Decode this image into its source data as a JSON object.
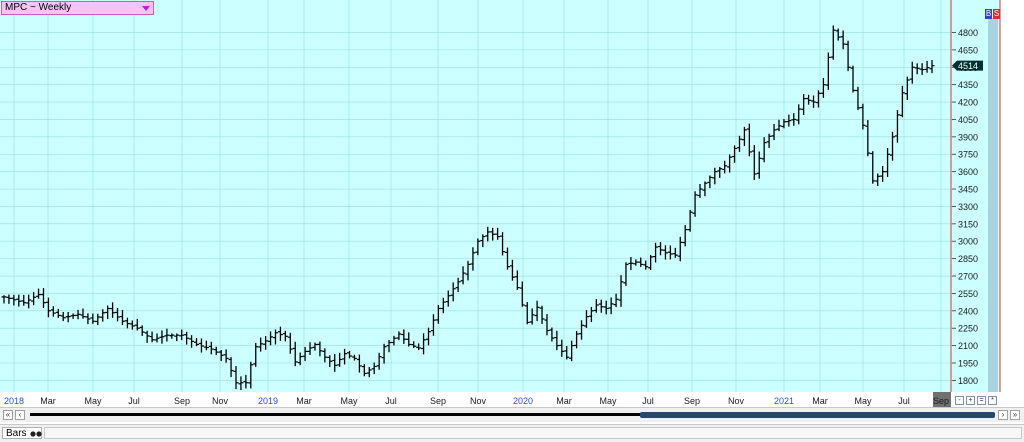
{
  "header": {
    "symbol_label": "MPC ~ Weekly"
  },
  "badges": {
    "b": "B",
    "s": "S"
  },
  "status": {
    "mode_label": "Bars"
  },
  "colors": {
    "plot_bg": "#ccffff",
    "grid": "#99dddd",
    "bar": "#000000",
    "marker_line": "#e03030",
    "axis_text": "#1a1a1a",
    "year_text": "#2050e0",
    "price_badge_bg": "#003030"
  },
  "chart_data": {
    "type": "bar",
    "style": "ohlc",
    "frequency": "weekly",
    "y_ticks": [
      1800,
      1950,
      2100,
      2250,
      2400,
      2550,
      2700,
      2850,
      3000,
      3150,
      3300,
      3450,
      3600,
      3750,
      3900,
      4050,
      4200,
      4350,
      4500,
      4650,
      4800
    ],
    "ylim": [
      1700,
      5080
    ],
    "last_price_label": "4514",
    "x_labels": [
      "2018",
      "Mar",
      "May",
      "Jul",
      "Sep",
      "Nov",
      "2019",
      "Mar",
      "May",
      "Jul",
      "Sep",
      "Nov",
      "2020",
      "Mar",
      "May",
      "Jul",
      "Sep",
      "Nov",
      "2021",
      "Mar",
      "May",
      "Jul",
      "Sep"
    ],
    "year_labels": [
      "2018",
      "2019",
      "2020",
      "2021"
    ],
    "anchors": [
      [
        0,
        2520
      ],
      [
        4,
        2470
      ],
      [
        7,
        2540
      ],
      [
        9,
        2400
      ],
      [
        12,
        2340
      ],
      [
        15,
        2370
      ],
      [
        18,
        2310
      ],
      [
        21,
        2420
      ],
      [
        24,
        2310
      ],
      [
        27,
        2250
      ],
      [
        30,
        2150
      ],
      [
        33,
        2190
      ],
      [
        36,
        2190
      ],
      [
        39,
        2110
      ],
      [
        42,
        2070
      ],
      [
        45,
        1990
      ],
      [
        47,
        1780
      ],
      [
        49,
        1780
      ],
      [
        51,
        2090
      ],
      [
        53,
        2140
      ],
      [
        55,
        2210
      ],
      [
        57,
        2180
      ],
      [
        59,
        1960
      ],
      [
        61,
        2050
      ],
      [
        63,
        2110
      ],
      [
        65,
        2000
      ],
      [
        67,
        1930
      ],
      [
        69,
        2030
      ],
      [
        71,
        1990
      ],
      [
        73,
        1860
      ],
      [
        75,
        1920
      ],
      [
        77,
        2090
      ],
      [
        80,
        2200
      ],
      [
        82,
        2110
      ],
      [
        84,
        2080
      ],
      [
        86,
        2220
      ],
      [
        88,
        2420
      ],
      [
        90,
        2530
      ],
      [
        92,
        2650
      ],
      [
        94,
        2800
      ],
      [
        96,
        3000
      ],
      [
        98,
        3080
      ],
      [
        100,
        3040
      ],
      [
        102,
        2780
      ],
      [
        104,
        2600
      ],
      [
        106,
        2300
      ],
      [
        108,
        2430
      ],
      [
        110,
        2230
      ],
      [
        112,
        2100
      ],
      [
        114,
        2000
      ],
      [
        116,
        2200
      ],
      [
        118,
        2350
      ],
      [
        120,
        2450
      ],
      [
        122,
        2420
      ],
      [
        124,
        2500
      ],
      [
        126,
        2800
      ],
      [
        128,
        2820
      ],
      [
        130,
        2780
      ],
      [
        132,
        2950
      ],
      [
        134,
        2900
      ],
      [
        136,
        2880
      ],
      [
        138,
        3100
      ],
      [
        140,
        3400
      ],
      [
        142,
        3500
      ],
      [
        144,
        3600
      ],
      [
        146,
        3650
      ],
      [
        148,
        3800
      ],
      [
        150,
        3960
      ],
      [
        152,
        3580
      ],
      [
        154,
        3850
      ],
      [
        156,
        3960
      ],
      [
        158,
        4030
      ],
      [
        160,
        4050
      ],
      [
        162,
        4230
      ],
      [
        164,
        4200
      ],
      [
        166,
        4350
      ],
      [
        168,
        4820
      ],
      [
        170,
        4700
      ],
      [
        172,
        4300
      ],
      [
        174,
        4000
      ],
      [
        176,
        3520
      ],
      [
        178,
        3600
      ],
      [
        180,
        3900
      ],
      [
        182,
        4280
      ],
      [
        184,
        4500
      ],
      [
        186,
        4480
      ],
      [
        188,
        4514
      ]
    ]
  }
}
